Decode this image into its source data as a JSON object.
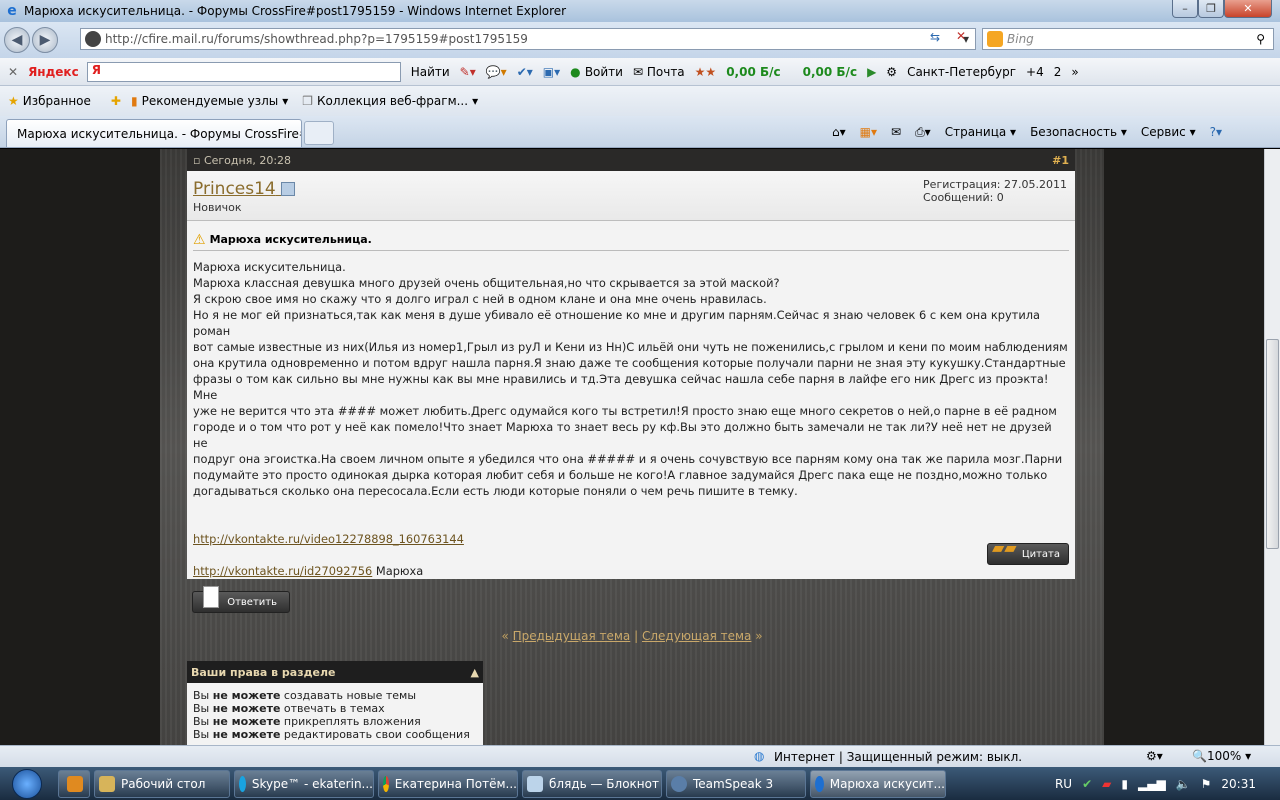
{
  "window": {
    "title": "Марюха искусительница. - Форумы CrossFire#post1795159 - Windows Internet Explorer"
  },
  "nav": {
    "url": "http://cfire.mail.ru/forums/showthread.php?p=1795159#post1795159",
    "search_placeholder": "Bing"
  },
  "yandex_bar": {
    "logo": "Яндекс",
    "ya": "Я",
    "find": "Найти",
    "login": "Войти",
    "mail": "Почта",
    "speed_in": "0,00 Б/с",
    "speed_out": "0,00 Б/с",
    "city": "Санкт-Петербург",
    "weather": "+4",
    "count": "2"
  },
  "favbar": {
    "favorites": "Избранное",
    "recommended": "Рекомендуемые узлы",
    "gallery": "Коллекция веб-фрагм..."
  },
  "tab": {
    "title": "Марюха искусительница. - Форумы CrossFire#..."
  },
  "cmdbar": {
    "page": "Страница",
    "security": "Безопасность",
    "tools": "Сервис"
  },
  "post": {
    "date": "Сегодня, 20:28",
    "number": "#1",
    "username": "Princes14",
    "rank": "Новичок",
    "registration": "Регистрация: 27.05.2011",
    "messages": "Сообщений: 0",
    "title": "Марюха искусительница.",
    "lines": [
      "Марюха искусительница.",
      "Марюха классная девушка много друзей очень общительная,но что скрывается за этой маской?",
      "Я скрою свое имя но скажу что я долго играл с ней в одном клане и она мне очень нравилась.",
      "Но я не мог ей признаться,так как меня в душе убивало её отношение ко мне и другим парням.Сейчас я знаю человек 6 с кем она крутила роман",
      "вот самые известные из них(Илья из номер1,Грыл из руЛ и Кени из Нн)С ильёй они чуть не поженились,с грылом и кени по моим наблюдениям",
      "она крутила одновременно и потом вдруг нашла парня.Я знаю даже те сообщения которые получали парни не зная эту кукушку.Стандартные",
      "фразы о том как сильно вы мне нужны как вы мне нравились и тд.Эта девушка сейчас нашла себе парня в лайфе его ник Дрегс из проэкта!Мне",
      "уже не верится что эта #### может любить.Дрегс одумайся кого ты встретил!Я просто знаю еще много секретов о ней,о парне в её радном",
      "городе и о том что рот у неё как помело!Что знает Марюха то знает весь ру кф.Вы это должно быть замечали не так ли?У неё нет не друзей не",
      "подруг она эгоистка.На своем личном опыте я убедился что она ##### и я очень сочувствую все парням кому она так же парила мозг.Парни",
      "подумайте это просто одинокая дырка которая любит себя и больше не кого!А главное задумайся Дрегс пака еще не поздно,можно только",
      "догадываться сколько она пересосала.Если есть люди которые поняли о чем речь пишите в темку."
    ],
    "link1": "http://vkontakte.ru/video12278898_160763144",
    "link2": "http://vkontakte.ru/id27092756",
    "link2_suffix": "Марюха",
    "quote_btn": "Цитата"
  },
  "reply_btn": "Ответить",
  "thread_nav": {
    "prev": "Предыдущая тема",
    "sep": "|",
    "next": "Следующая тема",
    "left": "«",
    "right": "»"
  },
  "rights": {
    "header": "Ваши права в разделе",
    "items": [
      {
        "a": "Вы",
        "b": "не можете",
        "c": "создавать новые темы"
      },
      {
        "a": "Вы",
        "b": "не можете",
        "c": "отвечать в темах"
      },
      {
        "a": "Вы",
        "b": "не можете",
        "c": "прикреплять вложения"
      },
      {
        "a": "Вы",
        "b": "не можете",
        "c": "редактировать свои сообщения"
      }
    ]
  },
  "statusbar": {
    "zone": "Интернет | Защищенный режим: выкл.",
    "zoom": "100%"
  },
  "taskbar": {
    "items": [
      "Рабочий стол",
      "Skype™ - ekaterin...",
      "Екатерина Потём...",
      "блядь — Блокнот",
      "TeamSpeak 3",
      "Марюха искусит..."
    ],
    "lang": "RU",
    "clock": "20:31"
  }
}
